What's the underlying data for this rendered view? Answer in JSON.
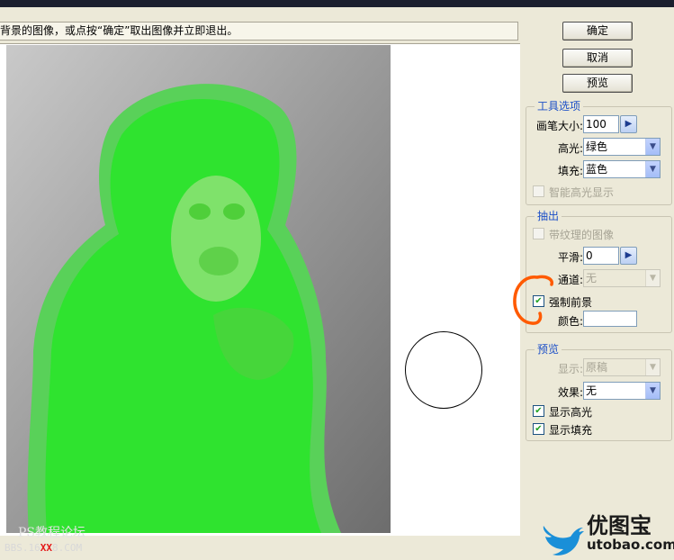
{
  "instruction": "背景的图像，或点按“确定”取出图像并立即退出。",
  "buttons": {
    "ok": "确定",
    "cancel": "取消",
    "preview": "预览"
  },
  "tool_options": {
    "title": "工具选项",
    "brush_size_label": "画笔大小:",
    "brush_size_value": "100",
    "highlight_label": "高光:",
    "highlight_value": "绿色",
    "fill_label": "填充:",
    "fill_value": "蓝色",
    "smart_highlight_label": "智能高光显示"
  },
  "extract": {
    "title": "抽出",
    "textured_label": "带纹理的图像",
    "smooth_label": "平滑:",
    "smooth_value": "0",
    "channel_label": "通道:",
    "channel_value": "无",
    "force_fg_label": "强制前景",
    "color_label": "颜色:"
  },
  "preview": {
    "title": "预览",
    "show_label": "显示:",
    "show_value": "原稿",
    "effect_label": "效果:",
    "effect_value": "无",
    "show_highlight_label": "显示高光",
    "show_fill_label": "显示填充"
  },
  "checkmark": "✔",
  "arrow_right": "▶",
  "arrow_down": "▼",
  "watermark": "PS教程论坛",
  "bbs": {
    "prefix": "BBS.16",
    "red": "XX",
    "suffix": "8.COM"
  },
  "brand": {
    "cn": "优图宝",
    "en": "utobao.com"
  },
  "colors": {
    "highlight_green": "#2fe32f",
    "annotation": "#ff5a00",
    "brand_blue": "#1a8fd8"
  }
}
